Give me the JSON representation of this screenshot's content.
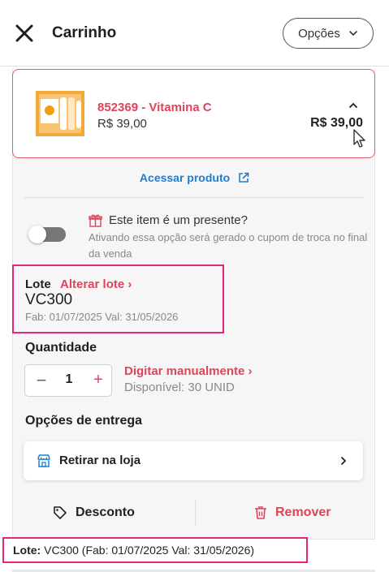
{
  "header": {
    "close_icon": "close-icon",
    "title": "Carrinho",
    "options_label": "Opções",
    "options_icon": "chevron-down-icon"
  },
  "product": {
    "name": "852369 - Vitamina C",
    "unit_price": "R$ 39,00",
    "total_price": "R$ 39,00",
    "collapse_icon": "chevron-up-icon",
    "image_icon": "product-box-image"
  },
  "access_product": {
    "label": "Acessar produto",
    "icon": "external-link-icon"
  },
  "gift": {
    "icon": "gift-icon",
    "title": "Este item é um presente?",
    "description": "Ativando essa opção será gerado o cupom de troca no final da venda",
    "enabled": false
  },
  "lote": {
    "label": "Lote",
    "change_label": "Alterar lote",
    "value": "VC300",
    "dates": "Fab: 01/07/2025 Val: 31/05/2026"
  },
  "quantity": {
    "label": "Quantidade",
    "minus": "−",
    "value": "1",
    "plus": "+",
    "manual_label": "Digitar manualmente",
    "available": "Disponível: 30 UNID"
  },
  "delivery": {
    "label": "Opções de entrega",
    "option": "Retirar na loja",
    "icon": "store-icon"
  },
  "actions": {
    "discount_label": "Desconto",
    "discount_icon": "tag-icon",
    "remove_label": "Remover",
    "remove_icon": "trash-icon"
  },
  "footer": {
    "label": "Lote:",
    "value": "VC300 (Fab: 01/07/2025 Val: 31/05/2026)"
  },
  "colors": {
    "accent": "#e0435c",
    "link": "#1a7fd4",
    "highlight": "#e8237a"
  }
}
